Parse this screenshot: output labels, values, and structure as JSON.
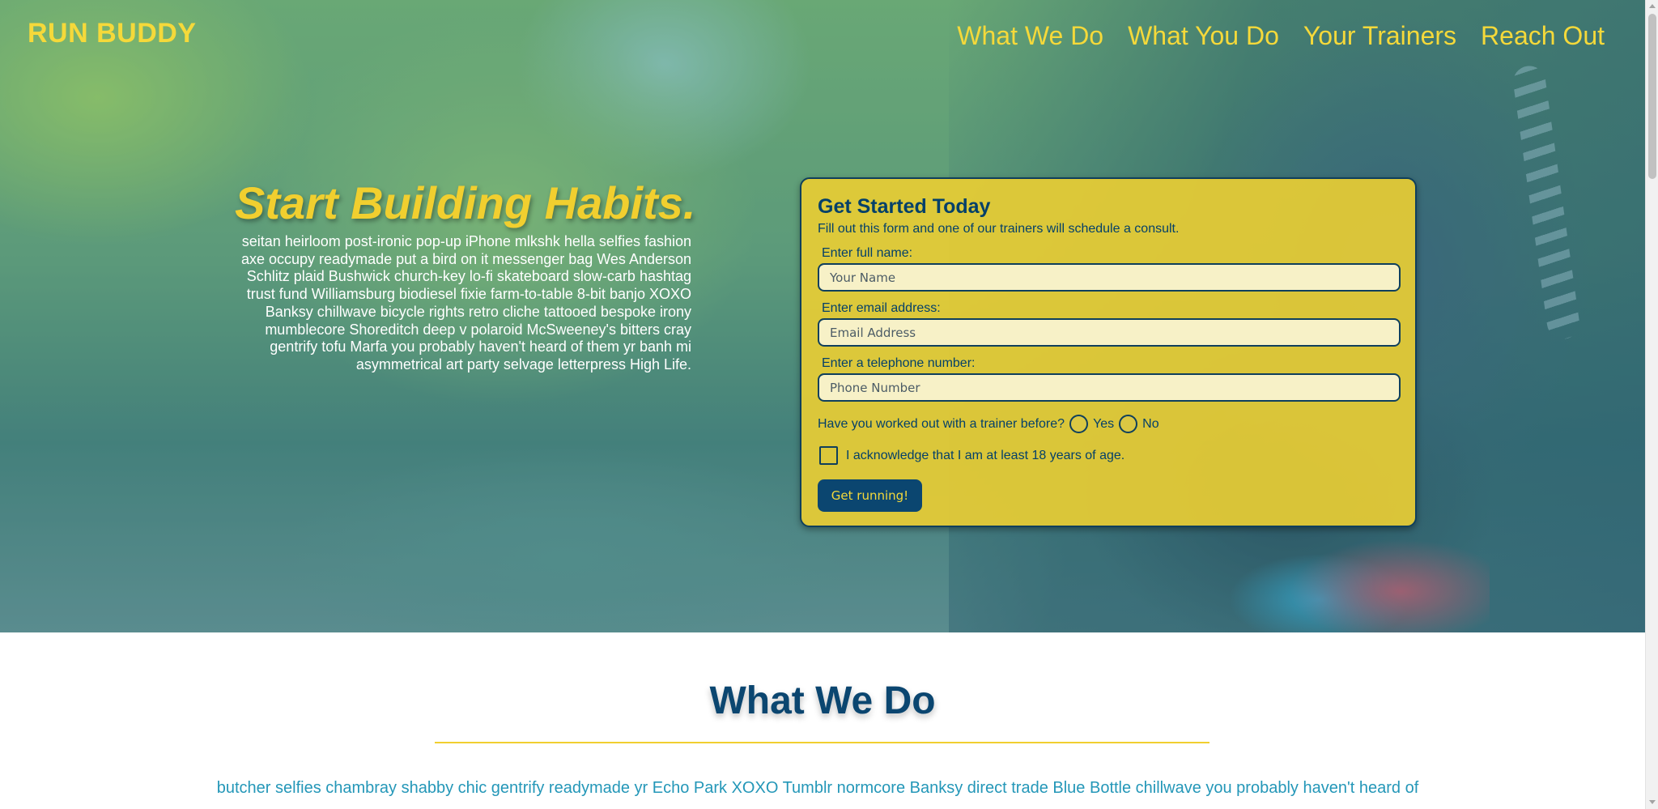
{
  "header": {
    "logo": "RUN BUDDY",
    "nav": [
      "What We Do",
      "What You Do",
      "Your Trainers",
      "Reach Out"
    ]
  },
  "hero": {
    "title": "Start Building Habits.",
    "text": "seitan heirloom post-ironic pop-up iPhone mlkshk hella selfies fashion axe occupy readymade put a bird on it messenger bag Wes Anderson Schlitz plaid Bushwick church-key lo-fi skateboard slow-carb hashtag trust fund Williamsburg biodiesel fixie farm-to-table 8-bit banjo XOXO Banksy chillwave bicycle rights retro cliche tattooed bespoke irony mumblecore Shoreditch deep v polaroid McSweeney's bitters cray gentrify tofu Marfa you probably haven't heard of them yr banh mi asymmetrical art party selvage letterpress High Life."
  },
  "form": {
    "title": "Get Started Today",
    "subtitle": "Fill out this form and one of our trainers will schedule a consult.",
    "name": {
      "label": "Enter full name:",
      "placeholder": "Your Name"
    },
    "email": {
      "label": "Enter email address:",
      "placeholder": "Email Address"
    },
    "phone": {
      "label": "Enter a telephone number:",
      "placeholder": "Phone Number"
    },
    "trainer_question": "Have you worked out with a trainer before?",
    "yes_label": "Yes",
    "no_label": "No",
    "age_ack": "I acknowledge that I am at least 18 years of age.",
    "submit": "Get running!"
  },
  "what_we_do": {
    "title": "What We Do",
    "text": "butcher selfies chambray shabby chic gentrify readymade yr Echo Park XOXO Tumblr normcore Banksy direct trade Blue Bottle chillwave you probably haven't heard of"
  },
  "colors": {
    "accent_yellow": "#f5d93a",
    "navy": "#0b4670",
    "teal_text": "#2497b8"
  }
}
